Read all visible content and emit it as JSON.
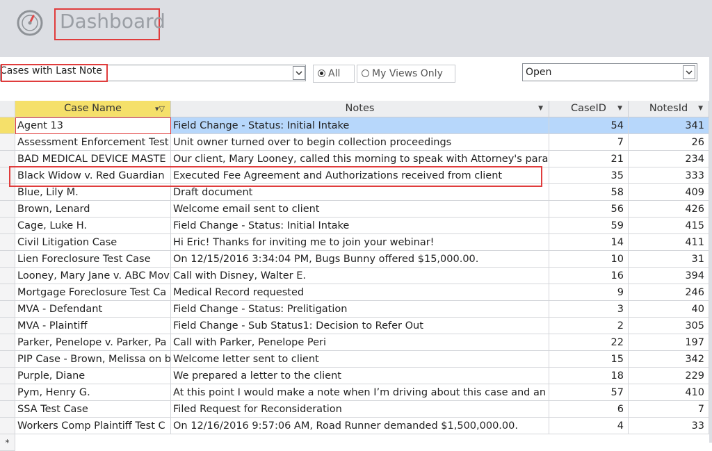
{
  "header": {
    "title": "Dashboard",
    "icon": "gauge-icon"
  },
  "filters": {
    "view_selected": "Cases with Last Note",
    "radio_all": "All",
    "radio_my_views": "My Views Only",
    "status_selected": "Open"
  },
  "grid": {
    "columns": [
      "Case Name",
      "Notes",
      "CaseID",
      "NotesId"
    ],
    "rows": [
      {
        "case": "Agent 13",
        "notes": "Field Change - Status: Initial Intake",
        "caseid": "54",
        "notesid": "341"
      },
      {
        "case": "Assessment Enforcement Test",
        "notes": "Unit owner turned over to begin collection proceedings",
        "caseid": "7",
        "notesid": "26"
      },
      {
        "case": "BAD MEDICAL DEVICE MASTE",
        "notes": "Our client, Mary Looney, called this morning to speak with Attorney's paral",
        "caseid": "21",
        "notesid": "234"
      },
      {
        "case": "Black Widow v. Red Guardian",
        "notes": "Executed Fee Agreement and Authorizations received from client",
        "caseid": "35",
        "notesid": "333"
      },
      {
        "case": "Blue, Lily M.",
        "notes": "Draft document",
        "caseid": "58",
        "notesid": "409"
      },
      {
        "case": "Brown, Lenard",
        "notes": "Welcome email sent to client",
        "caseid": "56",
        "notesid": "426"
      },
      {
        "case": "Cage, Luke H.",
        "notes": "Field Change - Status: Initial Intake",
        "caseid": "59",
        "notesid": "415"
      },
      {
        "case": "Civil Litigation Case",
        "notes": "Hi Eric!  Thanks for inviting me to join your webinar!",
        "caseid": "14",
        "notesid": "411"
      },
      {
        "case": "Lien Foreclosure Test Case",
        "notes": "On 12/15/2016 3:34:04 PM, Bugs Bunny offered $15,000.00.",
        "caseid": "10",
        "notesid": "31"
      },
      {
        "case": "Looney, Mary Jane v. ABC Mov",
        "notes": "Call with Disney, Walter E.",
        "caseid": "16",
        "notesid": "394"
      },
      {
        "case": "Mortgage Foreclosure Test Ca",
        "notes": "Medical Record requested",
        "caseid": "9",
        "notesid": "246"
      },
      {
        "case": "MVA - Defendant",
        "notes": "Field Change - Status: Prelitigation",
        "caseid": "3",
        "notesid": "40"
      },
      {
        "case": "MVA - Plaintiff",
        "notes": "Field Change - Sub Status1: Decision to Refer Out",
        "caseid": "2",
        "notesid": "305"
      },
      {
        "case": "Parker, Penelope v. Parker, Pa",
        "notes": "Call with Parker, Penelope Peri",
        "caseid": "22",
        "notesid": "197"
      },
      {
        "case": "PIP Case - Brown, Melissa on b",
        "notes": "Welcome letter sent to client",
        "caseid": "15",
        "notesid": "342"
      },
      {
        "case": "Purple, Diane",
        "notes": "We prepared a letter to the client",
        "caseid": "18",
        "notesid": "229"
      },
      {
        "case": "Pym, Henry G.",
        "notes": "At this point I would make a note when I’m driving about this case and an",
        "caseid": "57",
        "notesid": "410"
      },
      {
        "case": "SSA Test Case",
        "notes": "Filed Request for Reconsideration",
        "caseid": "6",
        "notesid": "7"
      },
      {
        "case": "Workers Comp Plaintiff Test C",
        "notes": "On 12/16/2016 9:57:06 AM, Road Runner demanded $1,500,000.00.",
        "caseid": "4",
        "notesid": "33"
      }
    ],
    "new_row_marker": "*"
  }
}
